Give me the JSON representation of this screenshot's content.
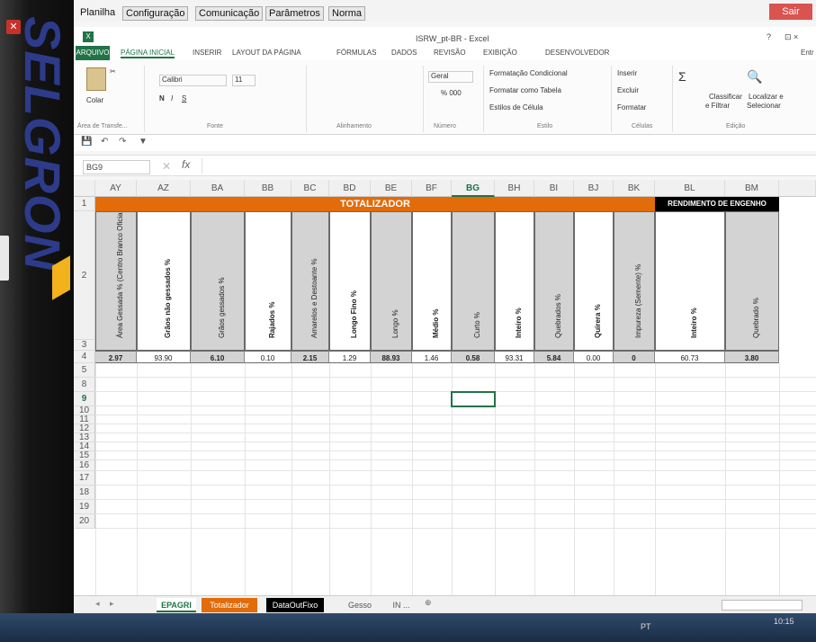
{
  "app_tabs": [
    "Planilha",
    "Configuração",
    "Comunicação",
    "Parâmetros",
    "Norma"
  ],
  "exit_label": "Sair",
  "excel": {
    "title": "ISRW_pt-BR - Excel",
    "help": "?",
    "window_controls": "⊡ ×"
  },
  "ribbon_tabs": [
    "ARQUIVO",
    "PÁGINA INICIAL",
    "INSERIR",
    "LAYOUT DA PÁGINA",
    "FÓRMULAS",
    "DADOS",
    "REVISÃO",
    "EXIBIÇÃO",
    "DESENVOLVEDOR",
    "Entr"
  ],
  "ribbon": {
    "paste": "Colar",
    "font_name": "Calibri",
    "font_size": "11",
    "bold": "N",
    "italic": "I",
    "underline": "S",
    "number_format": "Geral",
    "percent": "% 000",
    "cond_format": "Formatação Condicional",
    "format_table": "Formatar como Tabela",
    "cell_styles": "Estilos de Célula",
    "insert": "Inserir",
    "delete": "Excluir",
    "format": "Formatar",
    "sort_line1": "Classificar",
    "sort_line2": "e Filtrar",
    "find_line1": "Localizar e",
    "find_line2": "Selecionar",
    "groups": [
      "Área de Transfe...",
      "Fonte",
      "Alinhamento",
      "Número",
      "Estilo",
      "Células",
      "Edição"
    ]
  },
  "name_box": "BG9",
  "fx_label": "fx",
  "columns": [
    "AY",
    "AZ",
    "BA",
    "BB",
    "BC",
    "BD",
    "BE",
    "BF",
    "BG",
    "BH",
    "BI",
    "BJ",
    "BK",
    "BL",
    "BM"
  ],
  "banner_totalizador": "TOTALIZADOR",
  "banner_rendimento": "RENDIMENTO DE ENGENHO",
  "headers": [
    "Área Gessada % (Centro Branco Oficial Brasil)",
    "Grãos não gessados %",
    "Grãos gessados %",
    "Rajados %",
    "Amarelos e Destoante %",
    "Longo Fino %",
    "Longo %",
    "Médio %",
    "Curto %",
    "Inteiro %",
    "Quebrados %",
    "Quirera %",
    "Impureza (Semente) %",
    "Inteiro %",
    "Quebrado %"
  ],
  "values": [
    "2.97",
    "93.90",
    "6.10",
    "0.10",
    "2.15",
    "1.29",
    "88.93",
    "1.46",
    "0.58",
    "93.31",
    "5.84",
    "0.00",
    "0",
    "60.73",
    "3.80"
  ],
  "row_numbers": [
    "1",
    "2",
    "3",
    "4",
    "5",
    "8",
    "9",
    "10",
    "11",
    "12",
    "13",
    "14",
    "15",
    "16",
    "17",
    "18",
    "19",
    "20"
  ],
  "sheet_tabs": [
    "EPAGRI",
    "Totalizador",
    "DataOutFixo",
    "Gesso",
    "IN ..."
  ],
  "taskbar": {
    "time": "10:15",
    "lang": "PT"
  },
  "colors": {
    "excel_green": "#217346",
    "banner_orange": "#e26b0a",
    "header_gray": "#d3d3d3"
  }
}
